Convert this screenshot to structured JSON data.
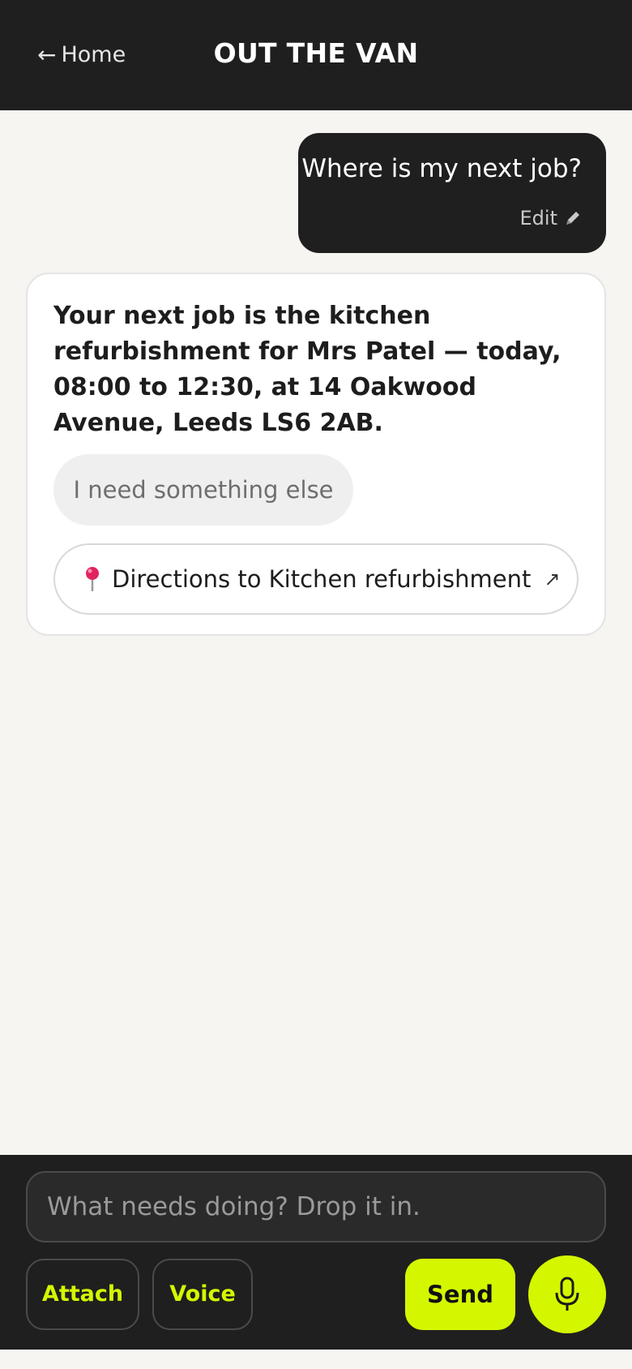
{
  "header": {
    "back_arrow": "←",
    "back_label": "Home",
    "title": "OUT THE VAN",
    "background": "#1f1f1f"
  },
  "conversation": {
    "user_message": "Where is my next job?",
    "edit_label": "Edit",
    "edit_icon": "pencil-icon",
    "assistant_message": "Your next job is the kitchen refurbishment for Mrs Patel — today, 08:00 to 12:30, at 14 Oakwood Avenue, Leeds LS6 2AB.",
    "suggestion_label": "I need something else",
    "directions_label": "Directions to Kitchen refurbishment",
    "directions_icon": "map-pin-icon",
    "external_icon": "↗"
  },
  "composer": {
    "placeholder": "What needs doing? Drop it in.",
    "value": "",
    "attach_label": "Attach",
    "voice_label": "Voice",
    "send_label": "Send",
    "mic_icon": "microphone-icon",
    "accent_color": "#d4f700"
  }
}
